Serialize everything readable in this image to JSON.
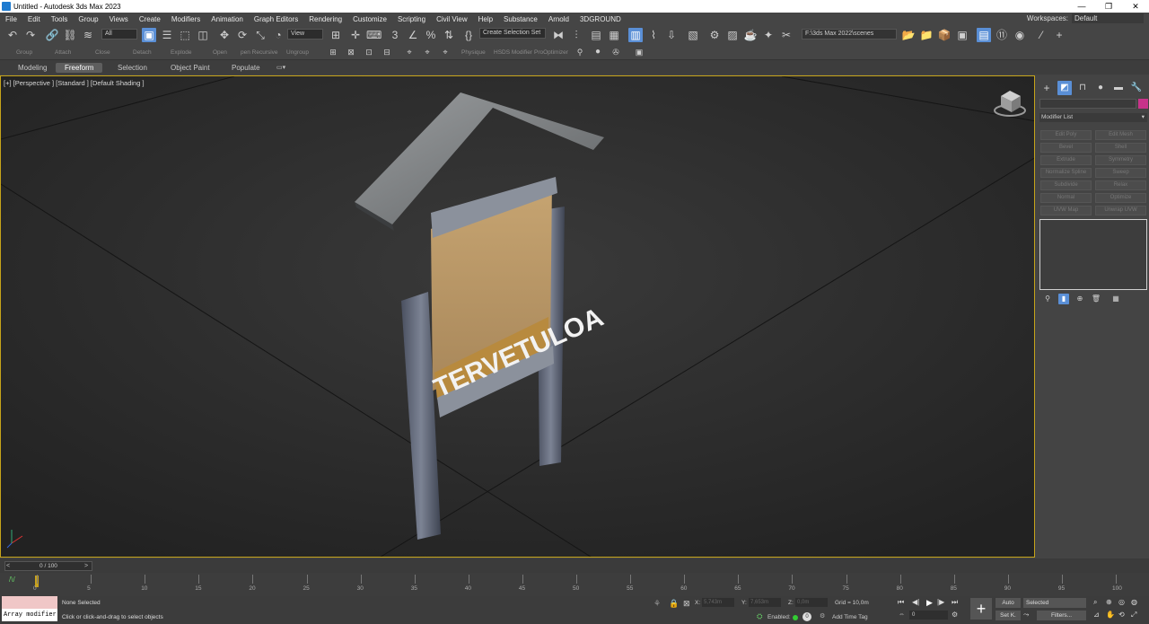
{
  "window": {
    "title": "Untitled - Autodesk 3ds Max 2023"
  },
  "menu": [
    "File",
    "Edit",
    "Tools",
    "Group",
    "Views",
    "Create",
    "Modifiers",
    "Animation",
    "Graph Editors",
    "Rendering",
    "Customize",
    "Scripting",
    "Civil View",
    "Help",
    "Substance",
    "Arnold",
    "3DGROUND"
  ],
  "workspace": {
    "label": "Workspaces:",
    "value": "Default"
  },
  "toolbar": {
    "selection_filter": "All",
    "ref_coord": "View",
    "named_selection": "Create Selection Set",
    "project_path": "F:\\3ds Max 2022\\scenes"
  },
  "subbar": [
    "Group",
    "Attach",
    "Close",
    "Detach",
    "Explode",
    "Open",
    "pen Recursive",
    "Ungroup",
    "Physique",
    "HSDS Modifier",
    "ProOptimizer"
  ],
  "ribbon_tabs": [
    "Modeling",
    "Freeform",
    "Selection",
    "Object Paint",
    "Populate"
  ],
  "ribbon_active": "Freeform",
  "viewport": {
    "label": "[+] [Perspective ] [Standard ] [Default Shading ]",
    "sign_text": "TERVETULOA"
  },
  "command_panel": {
    "modifier_list": "Modifier List",
    "buttons": [
      [
        "Edit Poly",
        "Edit Mesh"
      ],
      [
        "Bevel",
        "Shell"
      ],
      [
        "Extrude",
        "Symmetry"
      ],
      [
        "Normalize Spline",
        "Sweep"
      ],
      [
        "Subdivide",
        "Relax"
      ],
      [
        "Normal",
        "Optimize"
      ],
      [
        "UVW Map",
        "Unwrap UVW"
      ]
    ],
    "color_swatch": "#c8338a"
  },
  "timeline": {
    "frame_display": "0 / 100",
    "ticks": [
      "0",
      "5",
      "10",
      "15",
      "20",
      "25",
      "30",
      "35",
      "40",
      "45",
      "50",
      "55",
      "60",
      "65",
      "70",
      "75",
      "80",
      "85",
      "90",
      "95",
      "100"
    ]
  },
  "status": {
    "script_listener": "Array modifier",
    "selection": "None Selected",
    "prompt": "Click or click-and-drag to select objects",
    "x_label": "X:",
    "x_value": "5,743m",
    "y_label": "Y:",
    "y_value": "7,653m",
    "z_label": "Z:",
    "z_value": "0,0m",
    "grid": "Grid = 10,0m",
    "enabled_label": "Enabled:",
    "add_time_tag": "Add Time Tag",
    "auto": "Auto",
    "set_key": "Set K.",
    "key_filter_select": "Selected",
    "filters": "Filters...",
    "current_frame": "0"
  }
}
